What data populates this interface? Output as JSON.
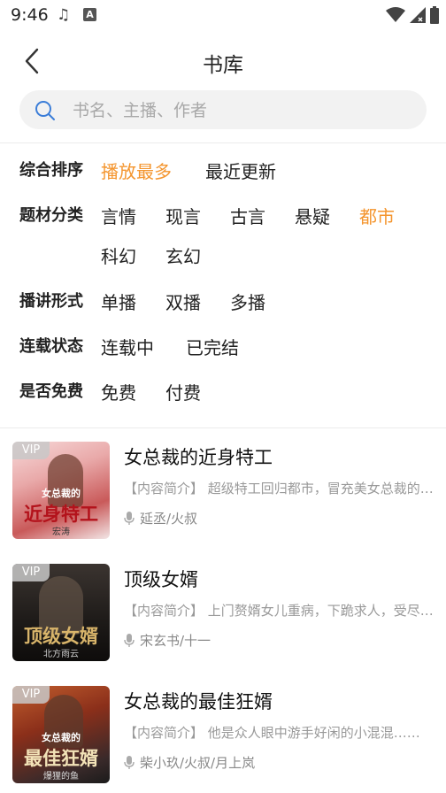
{
  "status_bar": {
    "time": "9:46",
    "a_icon": "A"
  },
  "header": {
    "title": "书库"
  },
  "search": {
    "placeholder": "书名、主播、作者"
  },
  "filters": {
    "sort": {
      "label": "综合排序",
      "options": [
        "播放最多",
        "最近更新"
      ],
      "active": "播放最多"
    },
    "genre": {
      "label": "题材分类",
      "options": [
        "言情",
        "现言",
        "古言",
        "悬疑",
        "都市",
        "科幻",
        "玄幻"
      ],
      "active": "都市"
    },
    "format": {
      "label": "播讲形式",
      "options": [
        "单播",
        "双播",
        "多播"
      ]
    },
    "status": {
      "label": "连载状态",
      "options": [
        "连载中",
        "已完结"
      ]
    },
    "free": {
      "label": "是否免费",
      "options": [
        "免费",
        "付费"
      ]
    }
  },
  "books": [
    {
      "title": "女总裁的近身特工",
      "desc": "【内容简介】 超级特工回归都市，冒充美女总裁的未婚夫……",
      "authors": "延丞/火叔",
      "vip": "VIP",
      "cover_text": "近身特工",
      "cover_small": "女总裁的",
      "cover_author": "宏涛"
    },
    {
      "title": "顶级女婿",
      "desc": "【内容简介】 上门赘婿女儿重病，下跪求人，受尽屈辱……",
      "authors": "宋玄书/十一",
      "vip": "VIP",
      "cover_text": "顶级女婿",
      "cover_author": "北方雨云"
    },
    {
      "title": "女总裁的最佳狂婿",
      "desc": "【内容简介】 他是众人眼中游手好闲的小混混……",
      "authors": "柴小玖/火叔/月上岚",
      "vip": "VIP",
      "cover_text": "最佳狂婿",
      "cover_small": "女总裁的",
      "cover_author": "爆狸的鱼"
    }
  ],
  "colors": {
    "accent": "#f4952e",
    "text": "#222222",
    "muted": "#999999"
  }
}
